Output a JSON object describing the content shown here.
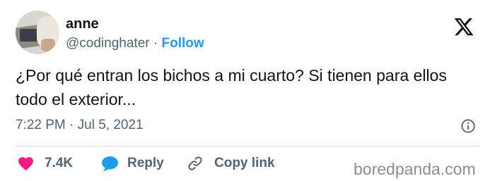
{
  "author": {
    "name": "anne",
    "handle": "@codinghater",
    "separator": "·",
    "follow_label": "Follow"
  },
  "tweet": {
    "text": "¿Por qué entran los bichos a mi cuarto? Si tienen para ellos todo el exterior...",
    "time": "7:22 PM",
    "date": "Jul 5, 2021",
    "meta_separator": "·"
  },
  "actions": {
    "like_count": "7.4K",
    "reply_label": "Reply",
    "copy_label": "Copy link"
  },
  "icons": {
    "logo": "x-logo-icon",
    "info": "info-icon",
    "like": "heart-icon",
    "reply": "speech-bubble-icon",
    "copy": "link-icon"
  },
  "colors": {
    "accent": "#1d9bf0",
    "like": "#f91880",
    "muted": "#536471",
    "text": "#0f1419"
  },
  "watermark": "boredpanda.com"
}
